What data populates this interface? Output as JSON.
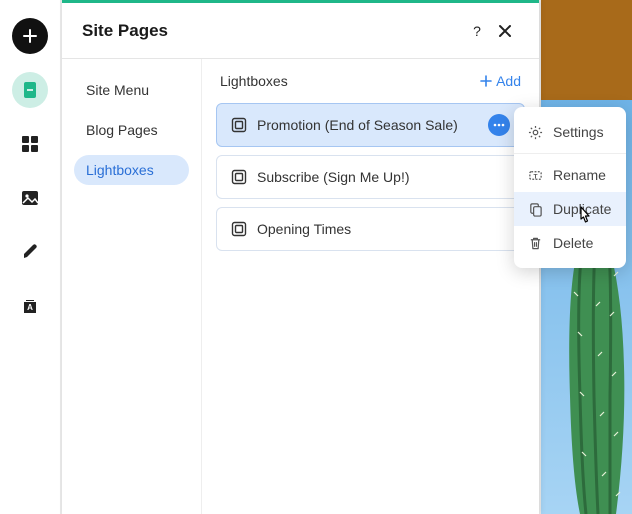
{
  "panel": {
    "title": "Site Pages"
  },
  "sidebar": {
    "items": [
      {
        "label": "Site Menu"
      },
      {
        "label": "Blog Pages"
      },
      {
        "label": "Lightboxes"
      }
    ]
  },
  "main": {
    "title": "Lightboxes",
    "add_label": "Add",
    "items": [
      {
        "label": "Promotion (End of Season Sale)"
      },
      {
        "label": "Subscribe (Sign Me Up!)"
      },
      {
        "label": "Opening Times"
      }
    ]
  },
  "context_menu": {
    "settings": "Settings",
    "rename": "Rename",
    "duplicate": "Duplicate",
    "delete": "Delete"
  }
}
